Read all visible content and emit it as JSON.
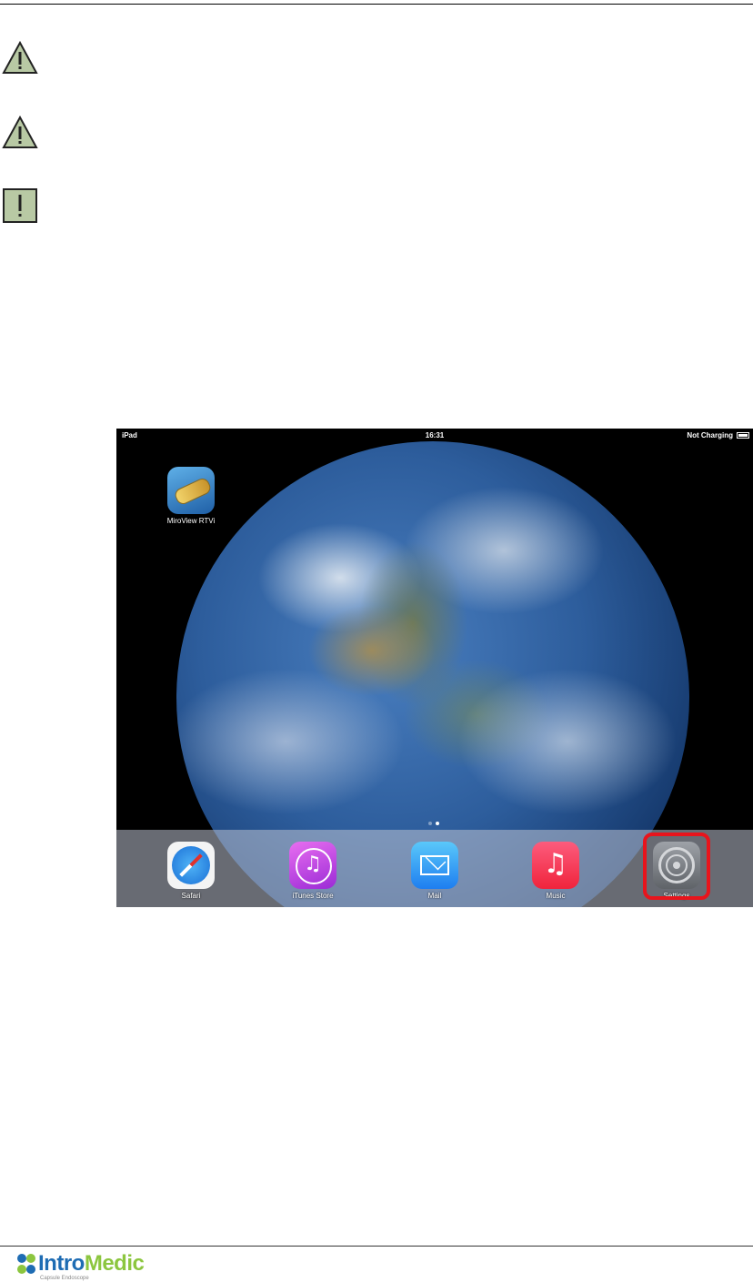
{
  "notices": [
    {
      "type": "warning",
      "icon": "warning-triangle-icon"
    },
    {
      "type": "warning",
      "icon": "warning-triangle-icon"
    },
    {
      "type": "caution",
      "icon": "exclamation-box-icon"
    }
  ],
  "screenshot": {
    "status_bar": {
      "device": "iPad",
      "time": "16:31",
      "battery_status": "Not Charging"
    },
    "home_apps": [
      {
        "label": "MiroView RTVi",
        "icon": "miroview-app-icon"
      }
    ],
    "dock": [
      {
        "label": "Safari",
        "icon": "safari-icon"
      },
      {
        "label": "iTunes Store",
        "icon": "itunes-store-icon"
      },
      {
        "label": "Mail",
        "icon": "mail-icon"
      },
      {
        "label": "Music",
        "icon": "music-icon"
      },
      {
        "label": "Settings",
        "icon": "settings-icon",
        "highlighted": true
      }
    ],
    "highlight_color": "#e8141c"
  },
  "footer": {
    "logo_text_1": "Intro",
    "logo_text_2": "Medic",
    "tagline": "Capsule Endoscope",
    "brand_colors": {
      "intro": "#1e6cb3",
      "medic": "#8cc63f"
    }
  }
}
